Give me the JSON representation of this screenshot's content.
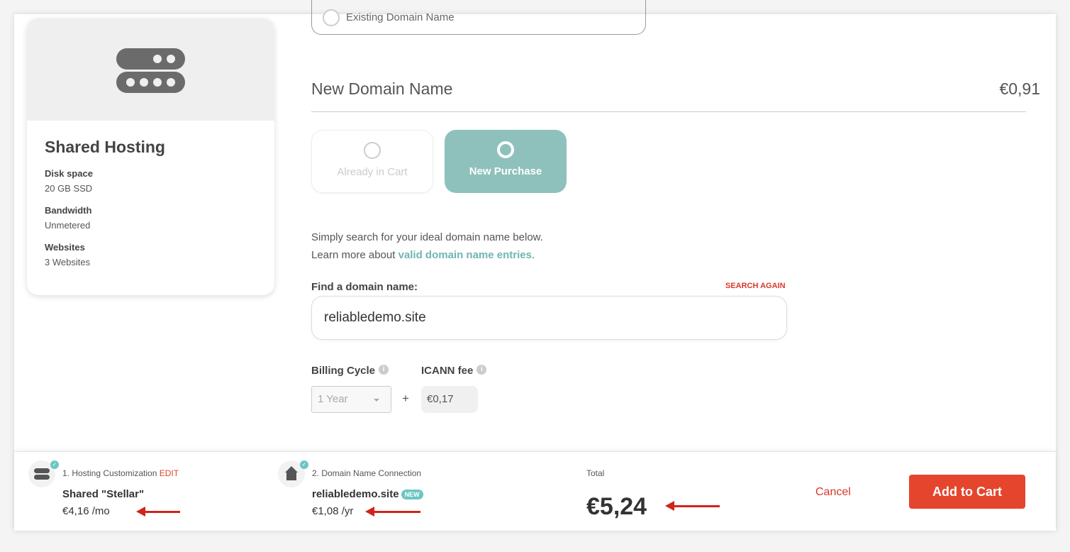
{
  "product": {
    "title": "Shared Hosting",
    "specs": [
      {
        "label": "Disk space",
        "value": "20 GB SSD"
      },
      {
        "label": "Bandwidth",
        "value": "Unmetered"
      },
      {
        "label": "Websites",
        "value": "3 Websites"
      }
    ],
    "icon": "server-icon"
  },
  "existing_option": "Existing Domain Name",
  "section": {
    "title": "New Domain Name",
    "price": "€0,91"
  },
  "options": [
    {
      "label": "Already in Cart",
      "selected": false
    },
    {
      "label": "New Purchase",
      "selected": true
    }
  ],
  "description": {
    "line1": "Simply search for your ideal domain name below.",
    "line2_prefix": "Learn more about ",
    "link": "valid domain name entries",
    "line2_suffix": "."
  },
  "search": {
    "label": "Find a domain name:",
    "again": "SEARCH AGAIN",
    "value": "reliabledemo.site"
  },
  "billing": {
    "label": "Billing Cycle",
    "value": "1 Year",
    "plus": "+",
    "fee_label": "ICANN fee",
    "fee": "€0,17"
  },
  "summary": {
    "step1": {
      "title": "1. Hosting Customization",
      "edit": "EDIT",
      "name": "Shared \"Stellar\"",
      "price": "€4,16 /mo"
    },
    "step2": {
      "title": "2. Domain Name Connection",
      "name": "reliabledemo.site",
      "badge": "NEW",
      "price": "€1,08 /yr"
    },
    "total_label": "Total",
    "total": "€5,24",
    "cancel": "Cancel",
    "add": "Add to Cart"
  },
  "colors": {
    "accent": "#8ec1bc",
    "cta": "#e5452d",
    "link": "#6fb6b0",
    "annotation_arrow": "#d0241c"
  }
}
